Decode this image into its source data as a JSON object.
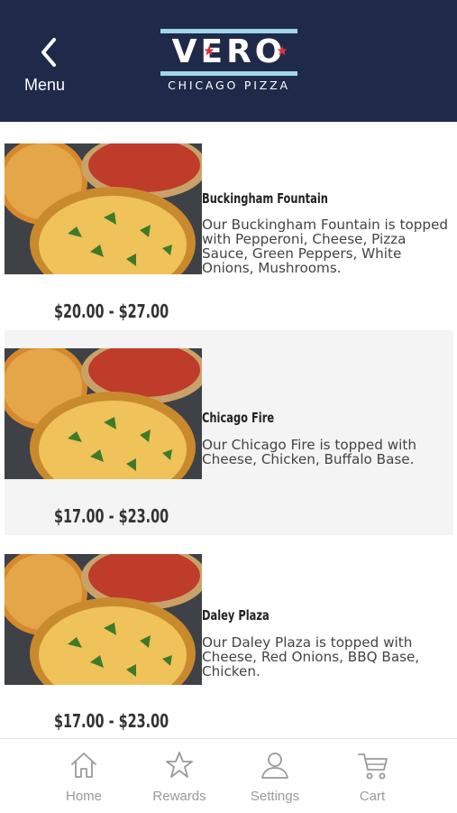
{
  "header": {
    "back_label": "Menu",
    "logo_word": "VERO",
    "logo_subtitle": "CHICAGO PIZZA"
  },
  "items": [
    {
      "name": "Buckingham Fountain",
      "description": "Our Buckingham Fountain is topped with Pepperoni, Cheese, Pizza Sauce, Green Peppers, White Onions, Mushrooms.",
      "price": "$20.00 - $27.00"
    },
    {
      "name": "Chicago Fire",
      "description": "Our Chicago Fire is topped with Cheese, Chicken, Buffalo Base.",
      "price": "$17.00 - $23.00"
    },
    {
      "name": "Daley Plaza",
      "description": "Our Daley Plaza is topped with Cheese, Red Onions, BBQ Base, Chicken.",
      "price": "$17.00 - $23.00"
    }
  ],
  "tabbar": {
    "tabs": [
      {
        "label": "Home",
        "icon": "home-icon"
      },
      {
        "label": "Rewards",
        "icon": "star-icon"
      },
      {
        "label": "Settings",
        "icon": "person-icon"
      },
      {
        "label": "Cart",
        "icon": "cart-icon"
      }
    ]
  },
  "colors": {
    "header_bg": "#1f2a4a",
    "logo_accent": "#9fd6ea",
    "star_red": "#e0313b",
    "tab_gray": "#9a9a9a",
    "alt_row": "#f4f4f4"
  }
}
